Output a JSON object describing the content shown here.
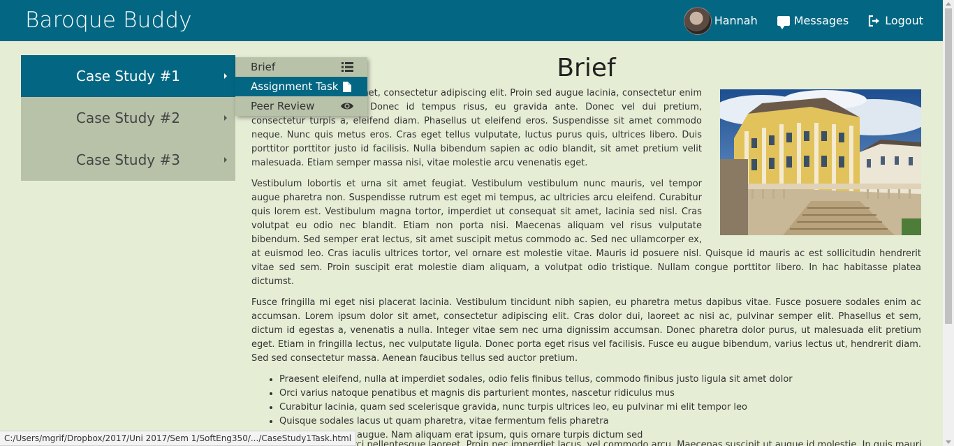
{
  "header": {
    "brand": "Baroque Buddy",
    "user_name": "Hannah",
    "messages_label": "Messages",
    "logout_label": "Logout"
  },
  "sidebar": {
    "items": [
      {
        "label": "Case Study #1",
        "active": true
      },
      {
        "label": "Case Study #2",
        "active": false
      },
      {
        "label": "Case Study #3",
        "active": false
      }
    ]
  },
  "submenu": {
    "items": [
      {
        "label": "Brief",
        "icon": "list-icon"
      },
      {
        "label": "Assignment Task",
        "icon": "file-icon"
      },
      {
        "label": "Peer Review",
        "icon": "eye-icon"
      }
    ]
  },
  "main": {
    "title": "Brief",
    "paragraphs": [
      "Lorem ipsum dolor sit amet, consectetur adipiscing elit. Proin sed augue lacinia, consectetur enim non, pellentesque nisi. Donec id tempus risus, eu gravida ante. Donec vel dui pretium, consectetur turpis a, eleifend diam. Phasellus ut eleifend eros. Suspendisse sit amet commodo neque. Nunc quis metus eros. Cras eget tellus vulputate, luctus purus quis, ultrices libero. Duis porttitor porttitor justo id facilisis. Nulla bibendum sapien ac odio blandit, sit amet pretium velit malesuada. Etiam semper massa nisi, vitae molestie arcu venenatis eget.",
      "Vestibulum lobortis et urna sit amet feugiat. Vestibulum vestibulum nunc mauris, vel tempor augue pharetra non. Suspendisse rutrum est eget mi tempus, ac ultricies arcu eleifend. Curabitur quis lorem est. Vestibulum magna tortor, imperdiet ut consequat sit amet, lacinia sed nisl. Cras volutpat eu odio nec blandit. Etiam non porta nisi. Maecenas aliquam vel risus vulputate bibendum. Sed semper erat lectus, sit amet suscipit metus commodo ac. Sed nec ullamcorper ex, at euismod leo. Cras iaculis ultrices tortor, vel ornare est molestie vitae. Mauris id posuere nisl. Quisque id mauris ac est sollicitudin hendrerit vitae sed sem. Proin suscipit erat molestie diam aliquam, a volutpat odio tristique. Nullam congue porttitor libero. In hac habitasse platea dictumst.",
      "Fusce fringilla mi eget nisi placerat lacinia. Vestibulum tincidunt nibh sapien, eu pharetra metus dapibus vitae. Fusce posuere sodales enim ac accumsan. Lorem ipsum dolor sit amet, consectetur adipiscing elit. Cras dolor dui, laoreet ac nisi ac, pulvinar semper elit. Phasellus et sem, dictum id egestas a, venenatis a nulla. Integer vitae sem nec urna dignissim accumsan. Donec pharetra dolor purus, ut malesuada elit pretium eget. Etiam in fringilla lectus, nec vulputate ligula. Donec porta eget risus vel facilisis. Fusce eu augue bibendum, varius lectus ut, hendrerit diam. Sed sed consectetur massa. Aenean faucibus tellus sed auctor pretium."
    ],
    "bullets": [
      "Praesent eleifend, nulla at imperdiet sodales, odio felis finibus tellus, commodo finibus justo ligula sit amet dolor",
      "Orci varius natoque penatibus et magnis dis parturient montes, nascetur ridiculus mus",
      "Curabitur lacinia, quam sed scelerisque gravida, nunc turpis ultrices leo, eu pulvinar mi elit tempor leo",
      "Quisque sodales lacus ut quam pharetra, vitae fermentum felis pharetra",
      "Nulla a tincidunt augue. Nam aliquam erat ipsum, quis ornare turpis dictum sed"
    ],
    "clipped_text": "Nulla mattis nisi non orci pellentesque laoreet. Proin nec imperdiet lacus, vel commodo arcu. Maecenas suscipit ut augue id molestie. In quis mauris"
  },
  "status_bar": {
    "url": "C:/Users/mgrif/Dropbox/2017/Uni 2017/Sem 1/SoftEng350/.../CaseStudy1Task.html"
  },
  "colors": {
    "header_bg": "#036783",
    "page_bg": "#e6edd5",
    "sidebar_bg": "#b8c2a9",
    "active_bg": "#036783"
  }
}
